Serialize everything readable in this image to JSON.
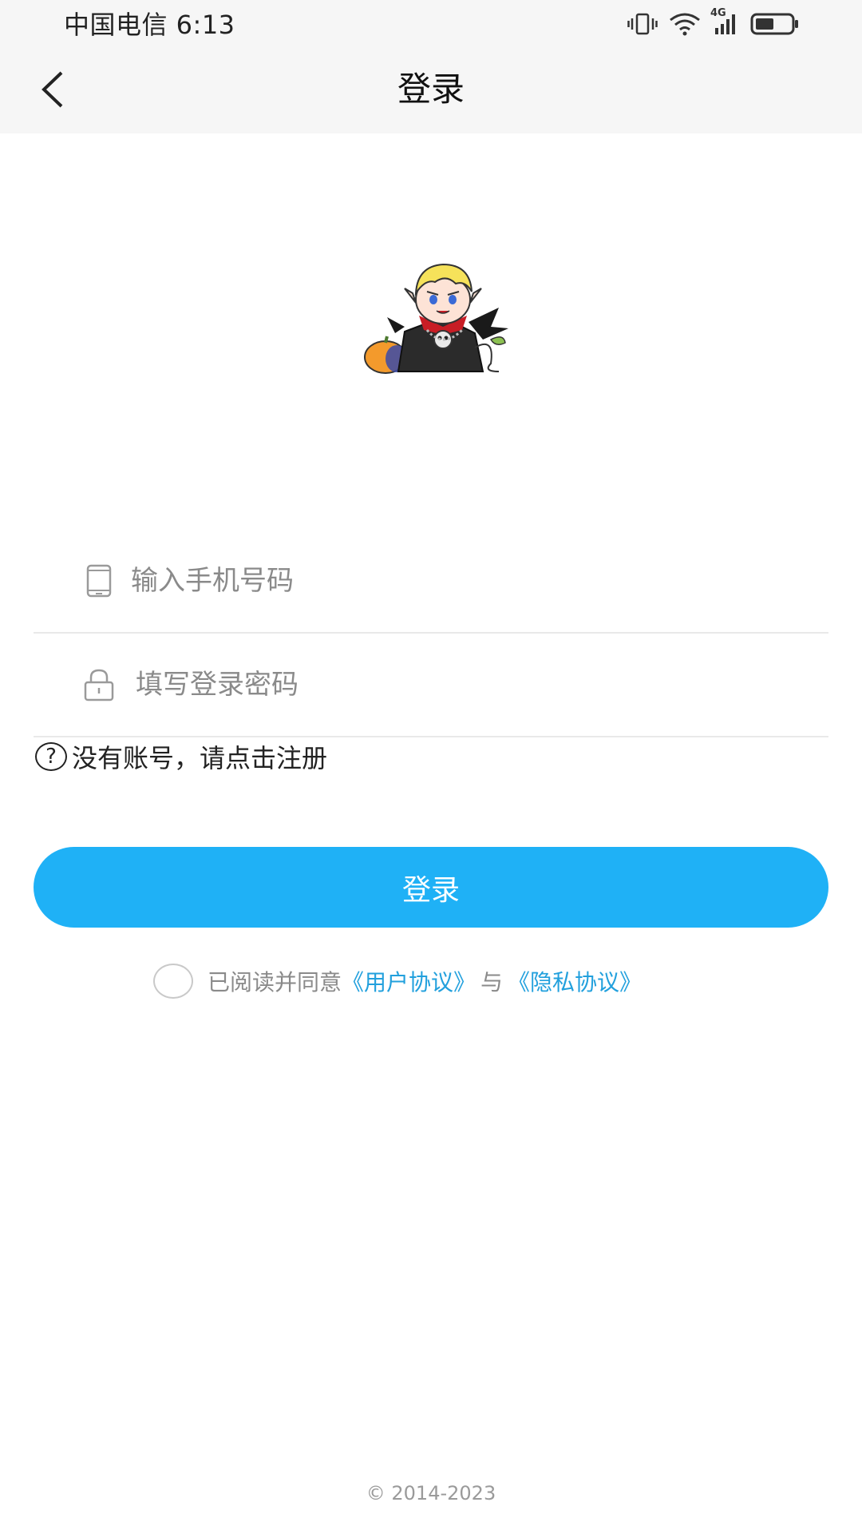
{
  "status_bar": {
    "carrier_time": "中国电信 6:13",
    "network_label": "4G",
    "icons": [
      "vibrate-icon",
      "wifi-icon",
      "signal-icon",
      "battery-icon"
    ]
  },
  "nav": {
    "title": "登录",
    "back_icon": "chevron-left-icon"
  },
  "login_form": {
    "phone": {
      "placeholder": "输入手机号码",
      "value": "",
      "icon": "phone-icon"
    },
    "password": {
      "placeholder": "填写登录密码",
      "value": "",
      "icon": "lock-icon"
    },
    "register_help_symbol": "?",
    "register_hint": "没有账号，请点击注册",
    "submit_label": "登录"
  },
  "agreement": {
    "prefix": "已阅读并同意",
    "user_agreement": "《用户协议》",
    "separator": "与",
    "privacy_agreement": "《隐私协议》",
    "checked": false
  },
  "footer": {
    "copyright": "© 2014-2023"
  },
  "colors": {
    "accent": "#1fb1f6",
    "link": "#22a0dd",
    "header_bg": "#f6f6f6"
  }
}
